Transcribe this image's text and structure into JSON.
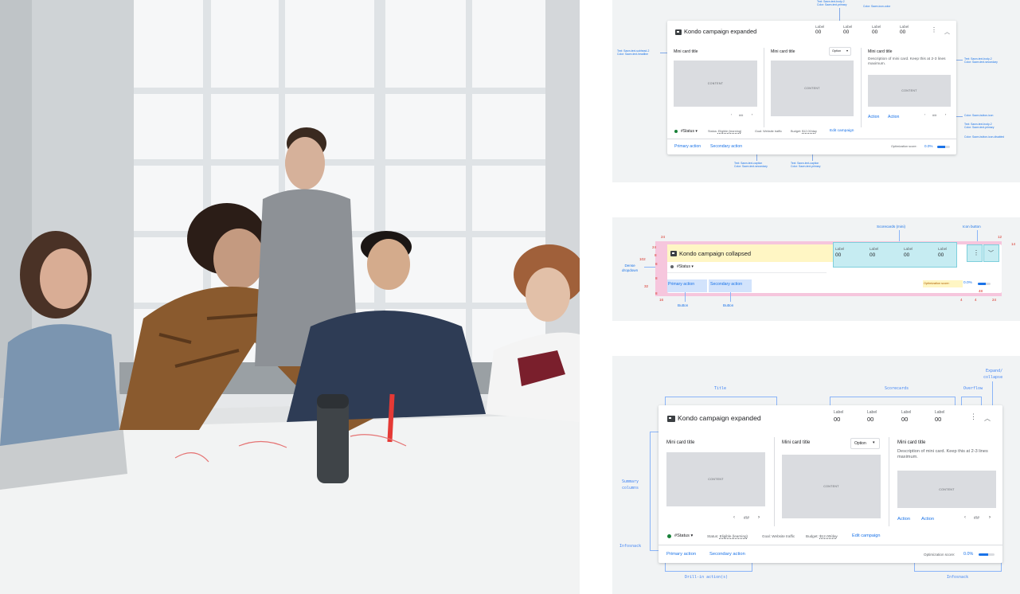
{
  "panel_expanded": {
    "title": "Kondo campaign expanded",
    "scorecards": [
      {
        "label": "Label",
        "value": "00"
      },
      {
        "label": "Label",
        "value": "00"
      },
      {
        "label": "Label",
        "value": "00"
      },
      {
        "label": "Label",
        "value": "00"
      }
    ],
    "mini_cards": [
      {
        "title": "Mini card title",
        "content": "CONTENT",
        "pager": "#/#"
      },
      {
        "title": "Mini card title",
        "content": "CONTENT",
        "option": "Option"
      },
      {
        "title": "Mini card title",
        "description": "Description of mini card. Keep this at 2-3 lines maximum.",
        "content": "CONTENT",
        "action1": "Action",
        "action2": "Action",
        "pager": "#/#"
      }
    ],
    "status": "#Status",
    "infosnack": {
      "status_label": "Status:",
      "status_value": "Eligible (learning)",
      "goal_label": "Goal:",
      "goal_value": "Website traffic",
      "budget_label": "Budget:",
      "budget_value": "$12.00/day",
      "edit": "Edit campaign"
    },
    "primary_action": "Primary action",
    "secondary_action": "Secondary action",
    "optimization_label": "Optimization score:",
    "optimization_value": "0.0%",
    "optimization_fraction": 0.6,
    "annotations": {
      "top_text_a": "Text: Sawn-text-body-2",
      "top_color_a": "Color: Sawn-text-primary",
      "top_color_b": "Color: Sawn-icon-color",
      "left_text": "Text: Sawn-text-subhead-2",
      "left_color": "Color: Sawn-text-headline",
      "right_text_1": "Text: Sawn-text-body-2",
      "right_color_1": "Color: Sawn-text-secondary",
      "right_color_2": "Color: Sawn-button-icon",
      "right_text_3": "Text: Sawn-text-body-2",
      "right_color_3": "Color: Sawn-text-primary",
      "right_color_4": "Color: Sawn-button-icon-disabled",
      "bottom_text_1": "Text: Sawn-text-caption",
      "bottom_color_1": "Color: Sawn-text-secondary",
      "bottom_text_2": "Text: Sawn-text-caption",
      "bottom_color_2": "Color: Sawn-text-primary"
    }
  },
  "panel_collapsed": {
    "title": "Kondo campaign collapsed",
    "scorecards_label": "Scorecards (mini)",
    "icon_button_label": "Icon button",
    "scorecards": [
      {
        "label": "Label",
        "value": "00"
      },
      {
        "label": "Label",
        "value": "00"
      },
      {
        "label": "Label",
        "value": "00"
      },
      {
        "label": "Label",
        "value": "00"
      }
    ],
    "status": "#Status",
    "dense_dropdown_line1": "Dense",
    "dense_dropdown_line2": "dropdown",
    "primary_action": "Primary action",
    "secondary_action": "Secondary action",
    "optimization_label": "Optimization score:",
    "optimization_value": "0.0%",
    "button_label_1": "Button",
    "button_label_2": "Button",
    "spacing": {
      "s24_top": "24",
      "s24_left": "24",
      "s8a": "8",
      "s102": "102",
      "s8b": "8",
      "s8c": "8",
      "s32": "32",
      "s8d": "8",
      "s16": "16",
      "s4a": "4",
      "s4b": "4",
      "s48": "48",
      "s24_bottom": "24",
      "s12": "12",
      "s14": "14"
    }
  },
  "panel_anatomy": {
    "title": "Kondo campaign expanded",
    "labels": {
      "title": "Title",
      "scorecards": "Scorecards",
      "overflow": "Overflow",
      "expand_line1": "Expand/",
      "expand_line2": "collapse",
      "summary_line1": "Summary",
      "summary_line2": "columns",
      "infosnack_left": "Infosnack",
      "drill_in": "Drill-in action(s)",
      "infosnack_bottom": "Infosnack"
    }
  },
  "colors": {
    "accent": "#1a73e8",
    "status_green": "#188038",
    "content_gray": "#dadce0",
    "spacing_red": "#d93025",
    "panel_bg": "#f1f3f4"
  }
}
